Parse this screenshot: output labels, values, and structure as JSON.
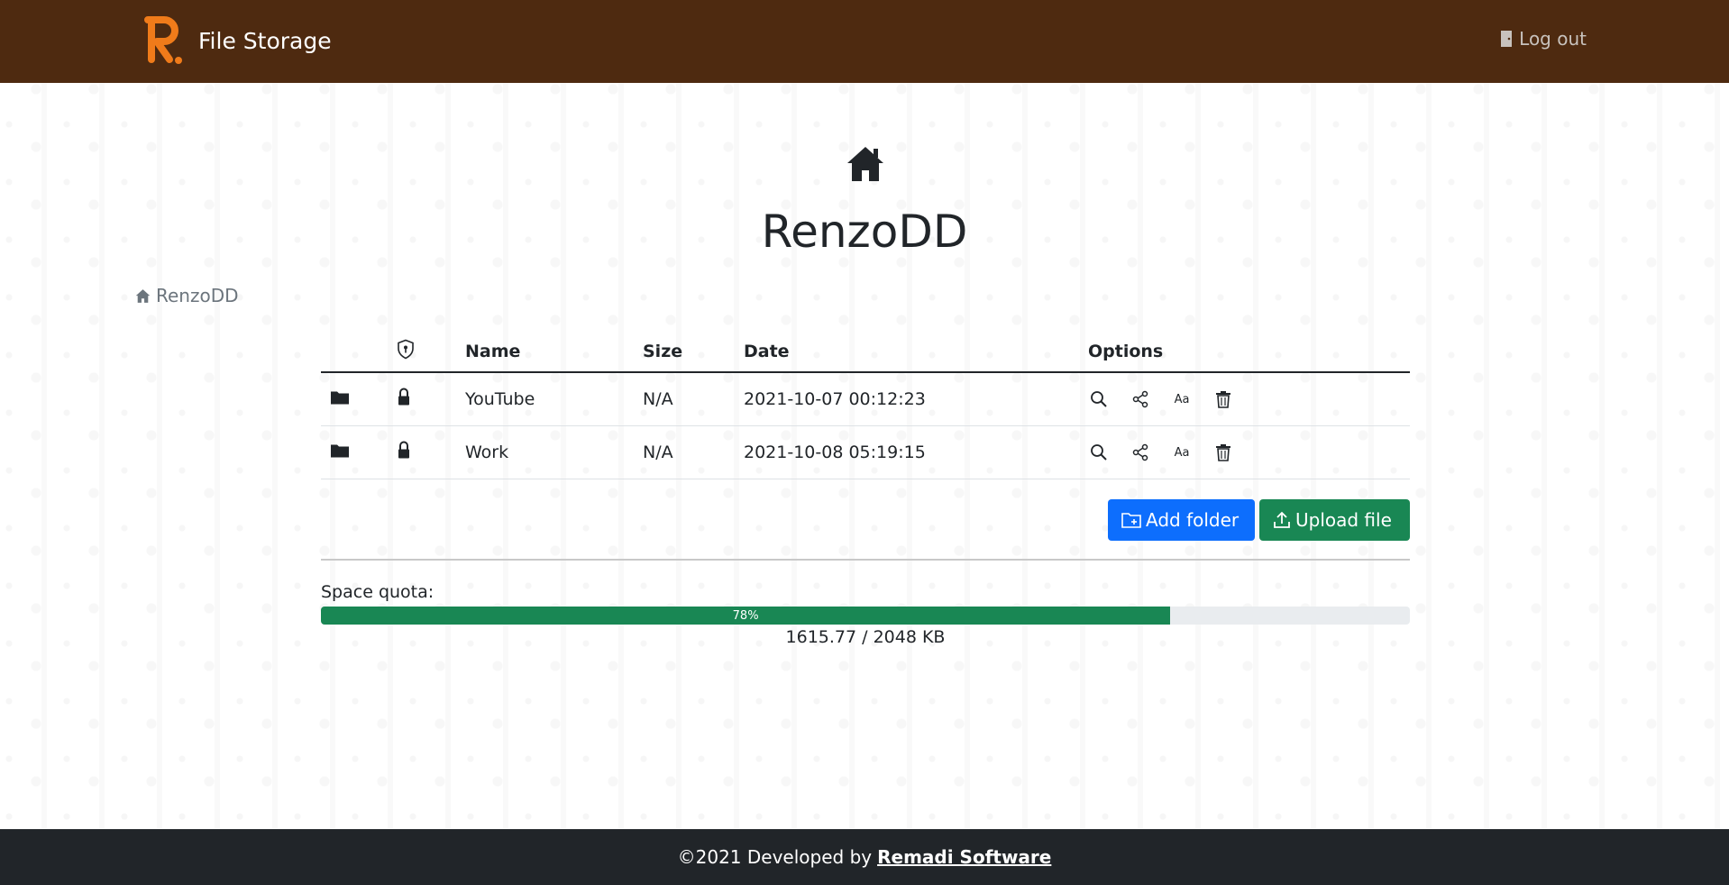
{
  "navbar": {
    "brand": "File Storage",
    "logout": "Log out",
    "bg_color": "#4e2a10",
    "logo_color": "#f07b1a"
  },
  "page": {
    "title": "RenzoDD",
    "breadcrumb": "RenzoDD"
  },
  "table": {
    "headers": {
      "name": "Name",
      "size": "Size",
      "date": "Date",
      "options": "Options"
    },
    "rows": [
      {
        "type_icon": "folder-icon",
        "lock_icon": "lock-icon",
        "name": "YouTube",
        "size": "N/A",
        "date": "2021-10-07 00:12:23"
      },
      {
        "type_icon": "folder-icon",
        "lock_icon": "lock-icon",
        "name": "Work",
        "size": "N/A",
        "date": "2021-10-08 05:19:15"
      }
    ],
    "option_icons": [
      "search-icon",
      "share-icon",
      "rename-icon",
      "trash-icon"
    ],
    "rename_glyph": "Aa"
  },
  "actions": {
    "add_folder": "Add folder",
    "upload_file": "Upload file",
    "add_color": "#0d6efd",
    "upload_color": "#198754"
  },
  "quota": {
    "label": "Space quota:",
    "percent": 78,
    "percent_text": "78%",
    "usage_text": "1615.77 / 2048 KB"
  },
  "footer": {
    "text": "©2021 Developed by",
    "link": "Remadi Software"
  }
}
